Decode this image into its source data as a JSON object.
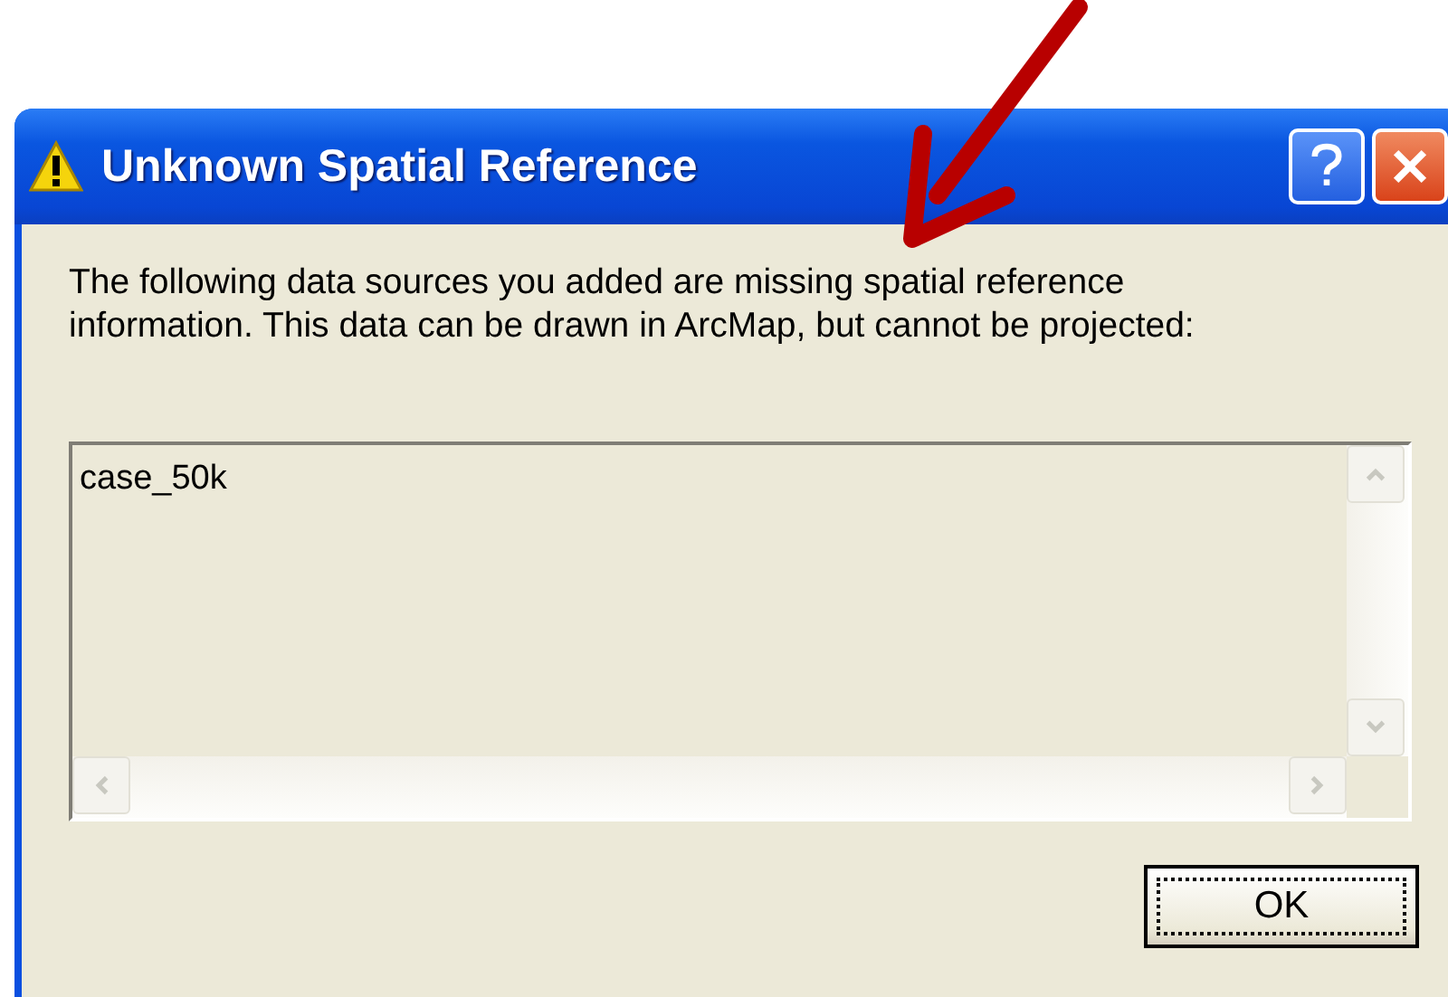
{
  "window": {
    "title": "Unknown Spatial Reference"
  },
  "message": "The following data sources you added are missing spatial reference information. This data can be drawn in ArcMap, but cannot be projected:",
  "list": {
    "items": [
      "case_50k"
    ]
  },
  "buttons": [
    {
      "label": "OK",
      "focused": true
    }
  ]
}
